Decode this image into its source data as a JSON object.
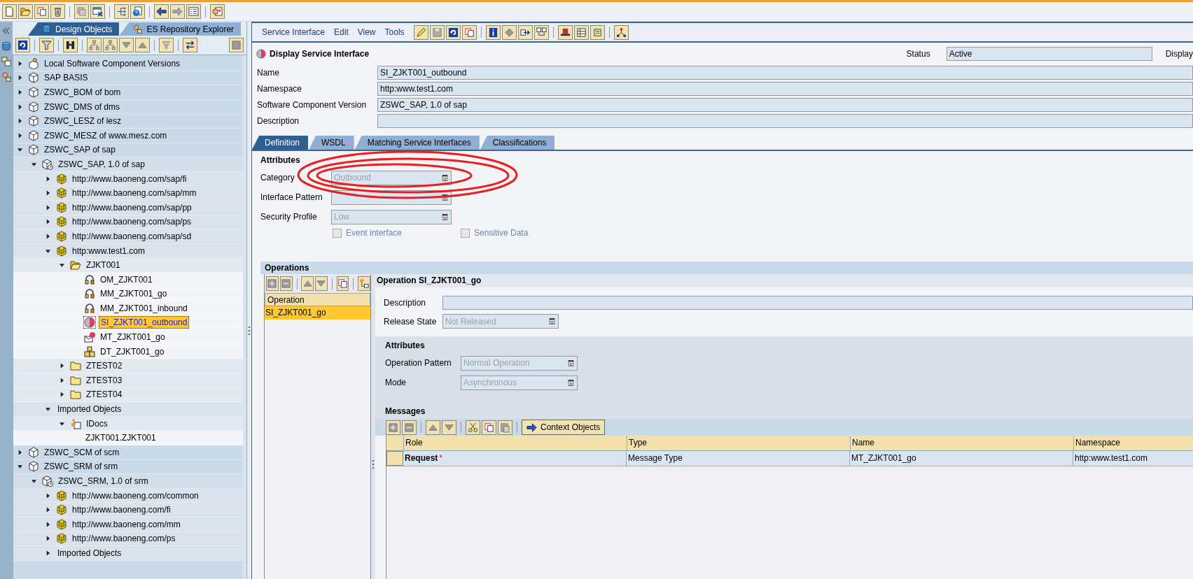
{
  "explorer": {
    "tabs": [
      {
        "label": "Design Objects",
        "selected": true
      },
      {
        "label": "ES Repository Explorer",
        "selected": false
      }
    ],
    "tree": [
      {
        "label": "Local Software Component Versions",
        "kind": "local",
        "expanded": false,
        "selected": false
      },
      {
        "label": "SAP BASIS",
        "kind": "swc",
        "expanded": false,
        "selected": false
      },
      {
        "label": "ZSWC_BOM of bom",
        "kind": "swc",
        "expanded": false,
        "selected": false
      },
      {
        "label": "ZSWC_DMS of dms",
        "kind": "swc",
        "expanded": false,
        "selected": false
      },
      {
        "label": "ZSWC_LESZ of lesz",
        "kind": "swc",
        "expanded": false,
        "selected": false
      },
      {
        "label": "ZSWC_MESZ of www.mesz.com",
        "kind": "swc",
        "expanded": false,
        "selected": false
      },
      {
        "label": "ZSWC_SAP of sap",
        "kind": "swc",
        "expanded": true,
        "selected": false,
        "children": [
          {
            "label": "ZSWC_SAP, 1.0 of sap",
            "kind": "swcv",
            "expanded": true,
            "selected": false,
            "children": [
              {
                "label": "http://www.baoneng.com/sap/fi",
                "kind": "ns",
                "expanded": false,
                "selected": false
              },
              {
                "label": "http://www.baoneng.com/sap/mm",
                "kind": "ns",
                "expanded": false,
                "selected": false
              },
              {
                "label": "http://www.baoneng.com/sap/pp",
                "kind": "ns",
                "expanded": false,
                "selected": false
              },
              {
                "label": "http://www.baoneng.com/sap/ps",
                "kind": "ns",
                "expanded": false,
                "selected": false
              },
              {
                "label": "http://www.baoneng.com/sap/sd",
                "kind": "ns",
                "expanded": false,
                "selected": false
              },
              {
                "label": "http:www.test1.com",
                "kind": "ns",
                "expanded": true,
                "selected": false,
                "children": [
                  {
                    "label": "ZJKT001",
                    "kind": "folder-open",
                    "expanded": true,
                    "selected": false,
                    "children": [
                      {
                        "label": "OM_ZJKT001",
                        "kind": "om",
                        "selected": false
                      },
                      {
                        "label": "MM_ZJKT001_go",
                        "kind": "mm",
                        "selected": false
                      },
                      {
                        "label": "MM_ZJKT001_inbound",
                        "kind": "mm",
                        "selected": false
                      },
                      {
                        "label": "SI_ZJKT001_outbound",
                        "kind": "si",
                        "selected": true
                      },
                      {
                        "label": "MT_ZJKT001_go",
                        "kind": "mt",
                        "selected": false
                      },
                      {
                        "label": "DT_ZJKT001_go",
                        "kind": "dt",
                        "selected": false
                      }
                    ]
                  },
                  {
                    "label": "ZTEST02",
                    "kind": "folder",
                    "expanded": false,
                    "selected": false
                  },
                  {
                    "label": "ZTEST03",
                    "kind": "folder",
                    "expanded": false,
                    "selected": false
                  },
                  {
                    "label": "ZTEST04",
                    "kind": "folder",
                    "expanded": false,
                    "selected": false
                  }
                ]
              },
              {
                "label": "Imported Objects",
                "kind": "none",
                "expanded": true,
                "selected": false,
                "children": [
                  {
                    "label": "IDocs",
                    "kind": "idoc",
                    "expanded": true,
                    "selected": false,
                    "children": [
                      {
                        "label": "ZJKT001.ZJKT001",
                        "kind": "none",
                        "selected": false
                      }
                    ]
                  }
                ]
              }
            ]
          }
        ]
      },
      {
        "label": "ZSWC_SCM of scm",
        "kind": "swc",
        "expanded": false,
        "selected": false
      },
      {
        "label": "ZSWC_SRM of srm",
        "kind": "swc",
        "expanded": true,
        "selected": false,
        "children": [
          {
            "label": "ZSWC_SRM, 1.0 of srm",
            "kind": "swcv",
            "expanded": true,
            "selected": false,
            "children": [
              {
                "label": "http://www.baoneng.com/common",
                "kind": "ns",
                "expanded": false,
                "selected": false
              },
              {
                "label": "http://www.baoneng.com/fi",
                "kind": "ns",
                "expanded": false,
                "selected": false
              },
              {
                "label": "http://www.baoneng.com/mm",
                "kind": "ns",
                "expanded": false,
                "selected": false
              },
              {
                "label": "http://www.baoneng.com/ps",
                "kind": "ns",
                "expanded": false,
                "selected": false
              },
              {
                "label": "Imported Objects",
                "kind": "none",
                "expanded": false,
                "selected": false
              }
            ]
          }
        ]
      }
    ]
  },
  "editor": {
    "menu": [
      "Service Interface",
      "Edit",
      "View",
      "Tools"
    ],
    "title": "Display Service Interface",
    "status": {
      "label": "Status",
      "value": "Active"
    },
    "display_label": "Display",
    "fields": [
      {
        "label": "Name",
        "value": "SI_ZJKT001_outbound"
      },
      {
        "label": "Namespace",
        "value": "http:www.test1.com"
      },
      {
        "label": "Software Component Version",
        "value": "ZSWC_SAP, 1.0 of sap"
      },
      {
        "label": "Description"
      }
    ],
    "tabs": [
      {
        "label": "Definition",
        "selected": true
      },
      {
        "label": "WSDL",
        "selected": false
      },
      {
        "label": "Matching Service Interfaces",
        "selected": false
      },
      {
        "label": "Classifications",
        "selected": false
      }
    ],
    "attributes": {
      "title": "Attributes",
      "dropdowns": [
        {
          "label": "Category",
          "value": "Outbound",
          "disabled": true
        },
        {
          "label": "Interface Pattern",
          "disabled": true
        },
        {
          "label": "Security Profile",
          "value": "Low",
          "disabled": true
        }
      ],
      "checkboxes": [
        {
          "label": "Event interface",
          "checked": false,
          "disabled": true
        },
        {
          "label": "Sensitive Data",
          "checked": false,
          "disabled": true
        }
      ]
    },
    "operations": {
      "title": "Operations",
      "column": "Operation",
      "rows": [
        {
          "name": "SI_ZJKT001_go",
          "selected": true
        }
      ],
      "detail": {
        "title": "Operation SI_ZJKT001_go",
        "description_label": "Description",
        "release": {
          "label": "Release State",
          "value": "Not Released",
          "disabled": true
        },
        "attributes_title": "Attributes",
        "attributes": [
          {
            "label": "Operation Pattern",
            "value": "Normal Operation",
            "disabled": true
          },
          {
            "label": "Mode",
            "value": "Asynchronous",
            "disabled": true
          }
        ],
        "messages_title": "Messages",
        "context_button": "Context Objects",
        "columns": [
          "Role",
          "Type",
          "Name",
          "Namespace"
        ],
        "rows": [
          {
            "role": "Request",
            "required_mark": "*",
            "type": "Message Type",
            "name": "MT_ZJKT001_go",
            "namespace": "http:www.test1.com"
          }
        ]
      }
    }
  }
}
